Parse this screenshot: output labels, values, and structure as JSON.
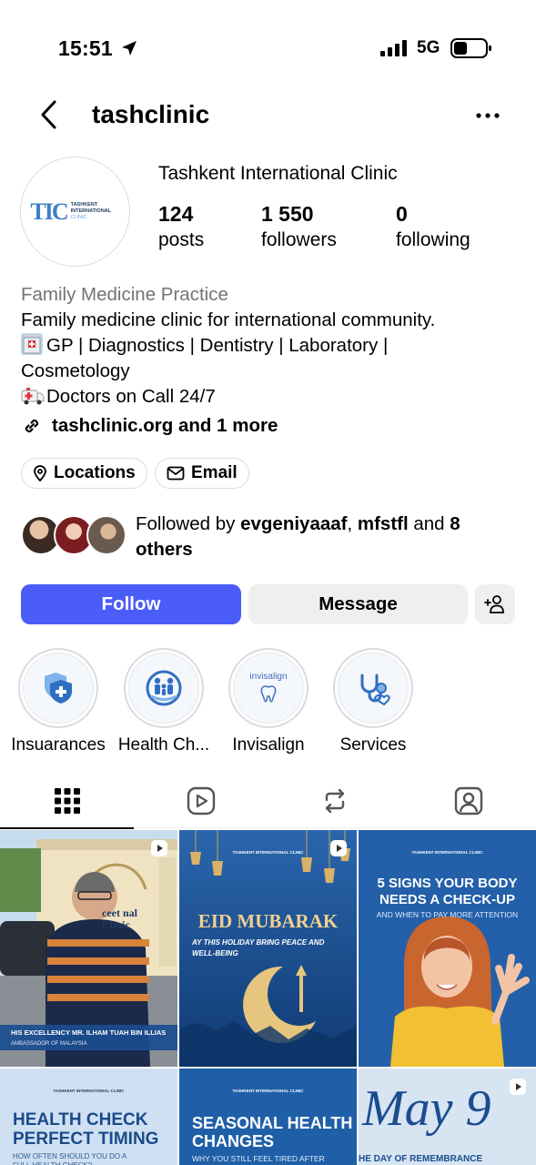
{
  "status": {
    "time": "15:51",
    "network": "5G"
  },
  "nav": {
    "username": "tashclinic"
  },
  "profile": {
    "full_name": "Tashkent International Clinic",
    "avatar_mark": "TIC",
    "avatar_line1": "TASHKENT",
    "avatar_line2": "INTERNATIONAL",
    "avatar_line3": "CLINIC",
    "stats": [
      {
        "value": "124",
        "label": "posts"
      },
      {
        "value": "1 550",
        "label": "followers"
      },
      {
        "value": "0",
        "label": "following"
      }
    ],
    "category": "Family Medicine Practice",
    "bio_line1": "Family medicine clinic for international community.",
    "bio_line2": "GP | Diagnostics | Dentistry | Laboratory |",
    "bio_line3": "Cosmetology",
    "bio_line4": "Doctors on Call 24/7",
    "link": "tashclinic.org and 1 more"
  },
  "chips": {
    "locations": "Locations",
    "email": "Email"
  },
  "followed_by": {
    "prefix": "Followed by ",
    "user1": "evgeniyaaaf",
    "sep": ", ",
    "user2": "mfstfl",
    "and": " and ",
    "others": "8 others"
  },
  "actions": {
    "follow": "Follow",
    "message": "Message"
  },
  "highlights": [
    {
      "label": "Insuarances",
      "icon": "shield-plus-icon"
    },
    {
      "label": "Health Ch...",
      "icon": "family-icon"
    },
    {
      "label": "Invisalign",
      "icon": "invisalign-icon",
      "brand": "invisalign"
    },
    {
      "label": "Services",
      "icon": "stethoscope-icon"
    }
  ],
  "tabs": [
    "grid-icon",
    "reels-icon",
    "reposts-icon",
    "tagged-icon"
  ],
  "posts": {
    "p1": {
      "banner_title": "HIS EXCELLENCY MR. ILHAM TUAH BIN ILLIAS",
      "banner_sub": "AMBASSADOR OF MALAYSIA",
      "sign": "ceet nal Clinic"
    },
    "p2": {
      "title": "EID MUBARAK",
      "sub": "AY THIS HOLIDAY BRING PEACE AND WELL-BEING"
    },
    "p3": {
      "title": "5 SIGNS YOUR BODY NEEDS A CHECK-UP",
      "sub": "AND WHEN TO PAY MORE ATTENTION"
    },
    "p4": {
      "title": "HEALTH CHECK PERFECT TIMING",
      "sub": "HOW OFTEN SHOULD YOU DO A FULL HEALTH CHECK?"
    },
    "p5": {
      "title": "SEASONAL HEALTH CHANGES",
      "sub": "WHY YOU STILL FEEL TIRED AFTER WINTER"
    },
    "p6": {
      "title": "May 9",
      "sub": "HE DAY OF REMEMBRANCE"
    },
    "clinic": "TASHKENT INTERNATIONAL CLINIC"
  },
  "colors": {
    "follow": "#4a5df9",
    "brand": "#3f7fc4",
    "post_blue": "#1d5ea8"
  }
}
